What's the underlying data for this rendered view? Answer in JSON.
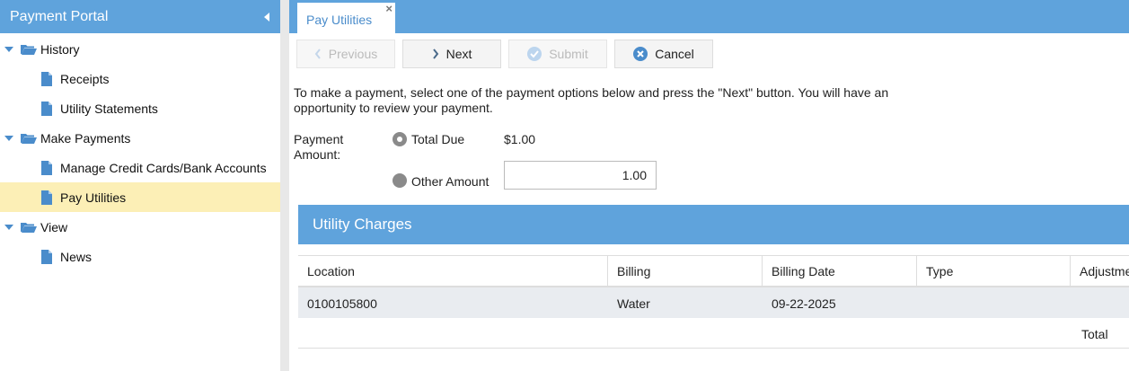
{
  "sidebar": {
    "title": "Payment Portal",
    "groups": [
      {
        "label": "History",
        "items": [
          {
            "label": "Receipts"
          },
          {
            "label": "Utility Statements"
          }
        ]
      },
      {
        "label": "Make Payments",
        "items": [
          {
            "label": "Manage Credit Cards/Bank Accounts"
          },
          {
            "label": "Pay Utilities",
            "selected": true
          }
        ]
      },
      {
        "label": "View",
        "items": [
          {
            "label": "News"
          }
        ]
      }
    ]
  },
  "tab": {
    "label": "Pay Utilities",
    "close": "×"
  },
  "toolbar": {
    "previous": "Previous",
    "next": "Next",
    "submit": "Submit",
    "cancel": "Cancel"
  },
  "intro": "To make a payment, select one of the payment options below and press the \"Next\" button.  You will have an opportunity to review your payment.",
  "payment": {
    "label": "Payment Amount:",
    "total_due_label": "Total Due",
    "total_due_value": "$1.00",
    "other_label": "Other Amount",
    "other_value": "1.00",
    "selected": "total_due"
  },
  "charges": {
    "title": "Utility Charges",
    "columns": [
      "Location",
      "Billing",
      "Billing Date",
      "Type",
      "Adjustme"
    ],
    "rows": [
      {
        "location": "0100105800",
        "billing": "Water",
        "billing_date": "09-22-2025",
        "type": "",
        "adjustment": ""
      }
    ],
    "footer_label": "Total"
  },
  "colors": {
    "accent": "#5fa3dc",
    "selected_row": "#fcefb6",
    "icon_blue": "#4a8ccb"
  }
}
